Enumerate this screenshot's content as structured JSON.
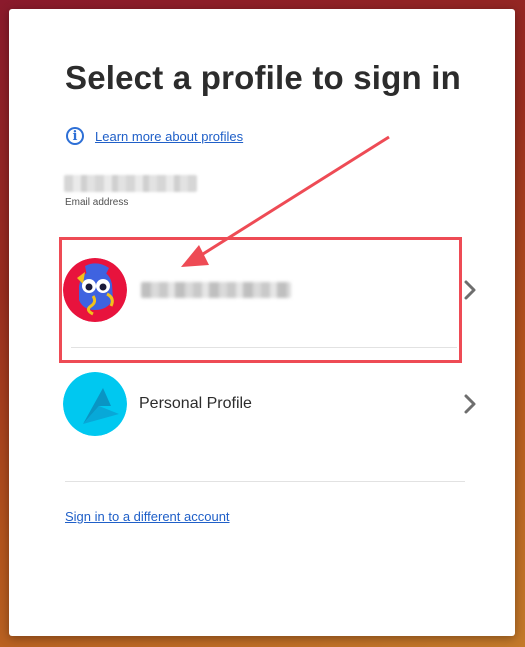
{
  "dialog": {
    "title": "Select a profile to sign in",
    "learn_more": "Learn more about profiles",
    "email_label": "Email address",
    "profiles": [
      {
        "name": "",
        "avatar": "cartoon-character-avatar",
        "chevron": "chevron-right-icon"
      },
      {
        "name": "Personal Profile",
        "avatar": "personal-profile-avatar",
        "chevron": "chevron-right-icon"
      }
    ],
    "different_account": "Sign in to a different account"
  },
  "annotation": {
    "highlight_color": "#ee4b55"
  },
  "colors": {
    "link": "#1f5fc8",
    "info_icon": "#2d6fd6",
    "personal_avatar": "#00c8f0"
  }
}
